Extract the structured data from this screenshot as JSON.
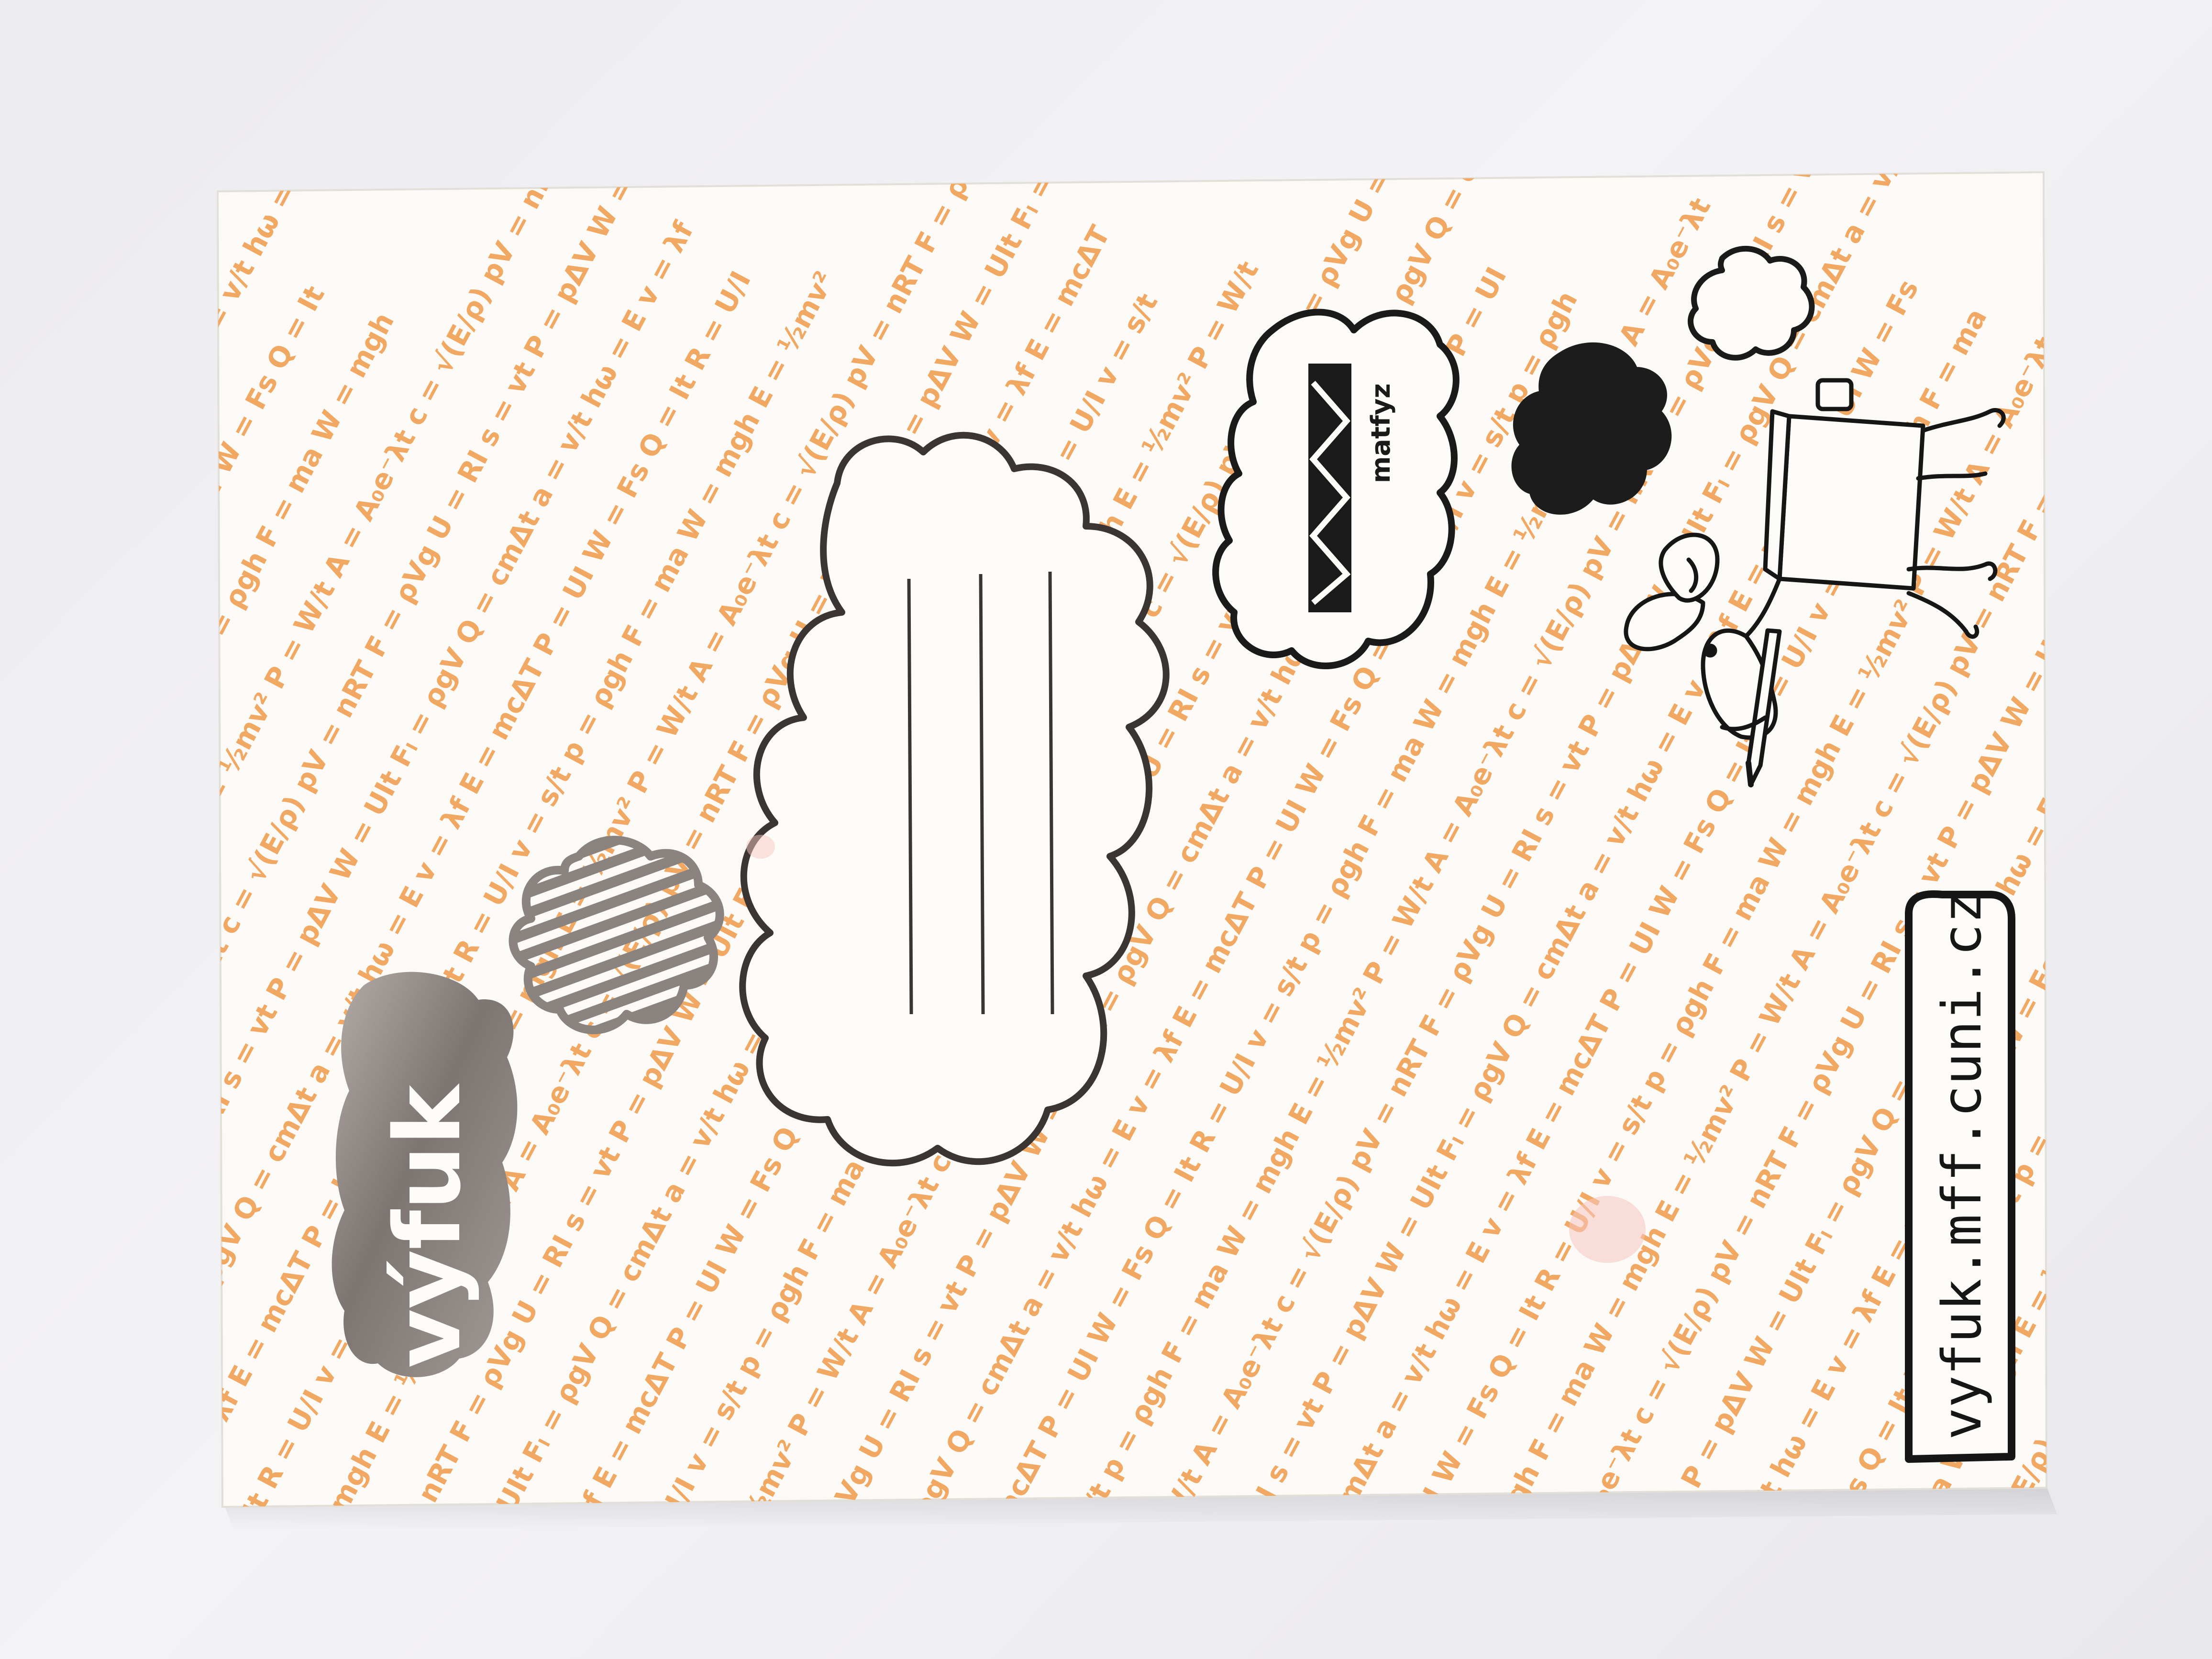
{
  "photo": {
    "subject": "notebook-cover",
    "background_color": "#eeedf1",
    "paper_color": "#fbfaf6",
    "pattern_color": "#f0a862",
    "ink_color": "#161616",
    "foil_color": "#8f8782"
  },
  "cover": {
    "brand_logo_text": "výfuk",
    "partner_logo_text": "matfyz",
    "url": "vyfuk.mff.cuni.cz"
  },
  "formula_pattern": [
    "E = mcΔT",
    "P = UI",
    "W = Fs",
    "Q = It",
    "R = U/I",
    "v = s/t",
    "p = ρgh",
    "F = ma",
    "W = mgh",
    "E = ½mv²",
    "P = W/t",
    "A = A₀e⁻λt",
    "c = √(E/ρ)",
    "pV = nRT",
    "F = ρVg",
    "U = RI",
    "s = vt",
    "P = pΔV",
    "W = UIt",
    "Fₗ = ρgV",
    "Q = cmΔt",
    "a = v/t",
    "hω = E",
    "v = λf"
  ],
  "icons": {
    "writing-cloud": "cloud-with-lines-icon",
    "striped-cloud": "striped-cloud-icon",
    "dark-cloud": "filled-cloud-icon",
    "small-cloud": "small-cloud-outline-icon",
    "mascot": "cartoon-animal-writing-icon",
    "pencil": "pencil-icon"
  }
}
